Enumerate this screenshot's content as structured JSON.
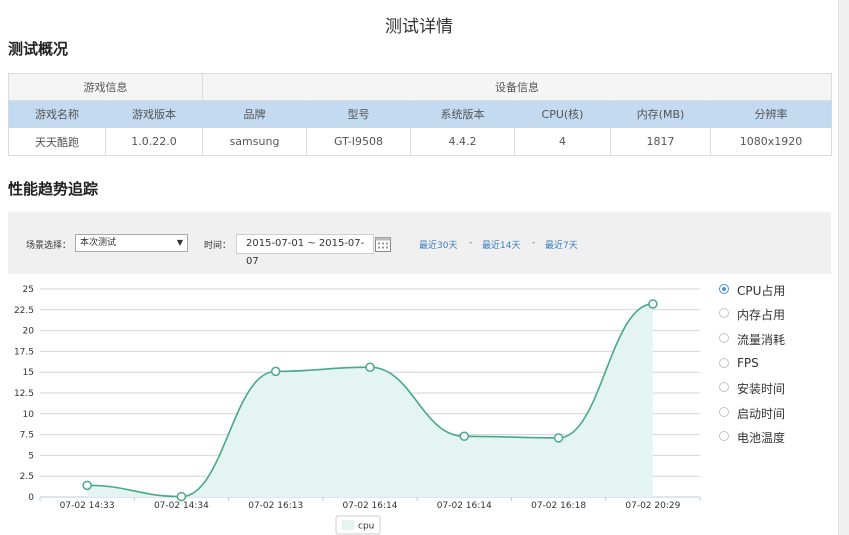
{
  "page_title": "测试详情",
  "overview": {
    "title": "测试概况",
    "groups": [
      "游戏信息",
      "设备信息"
    ],
    "headers": [
      "游戏名称",
      "游戏版本",
      "品牌",
      "型号",
      "系统版本",
      "CPU(核)",
      "内存(MB)",
      "分辨率"
    ],
    "values": [
      "天天酷跑",
      "1.0.22.0",
      "samsung",
      "GT-I9508",
      "4.4.2",
      "4",
      "1817",
      "1080x1920"
    ]
  },
  "trend": {
    "title": "性能趋势追踪",
    "scene_label": "场景选择：",
    "scene_value": "本次测试",
    "time_label": "时间：",
    "date_range": "2015-07-01 ~ 2015-07-07",
    "quick_ranges": [
      "最近30天",
      "最近14天",
      "最近7天"
    ],
    "quick_sep": "-",
    "metrics": [
      "CPU占用",
      "内存占用",
      "流量消耗",
      "FPS",
      "安装时间",
      "启动时间",
      "电池温度"
    ],
    "selected_metric": 0
  },
  "colors": {
    "line": "#48a98a",
    "area": "#e3f4f1",
    "header_row": "#c4daf0",
    "filter_bar": "#f0f0f0",
    "link": "#3a7fc1"
  },
  "chart_data": {
    "type": "area",
    "categories": [
      "07-02 14:33",
      "07-02 14:34",
      "07-02 16:13",
      "07-02 16:14",
      "07-02 16:14",
      "07-02 16:18",
      "07-02 20:29"
    ],
    "series": [
      {
        "name": "cpu",
        "values": [
          1.4,
          0.05,
          15.1,
          15.6,
          7.3,
          7.1,
          23.2
        ]
      }
    ],
    "yticks": [
      0,
      2.5,
      5,
      7.5,
      10,
      12.5,
      15,
      17.5,
      20,
      22.5,
      25
    ],
    "ylim": [
      0,
      25
    ],
    "grid": true,
    "legend": "bottom-center"
  }
}
